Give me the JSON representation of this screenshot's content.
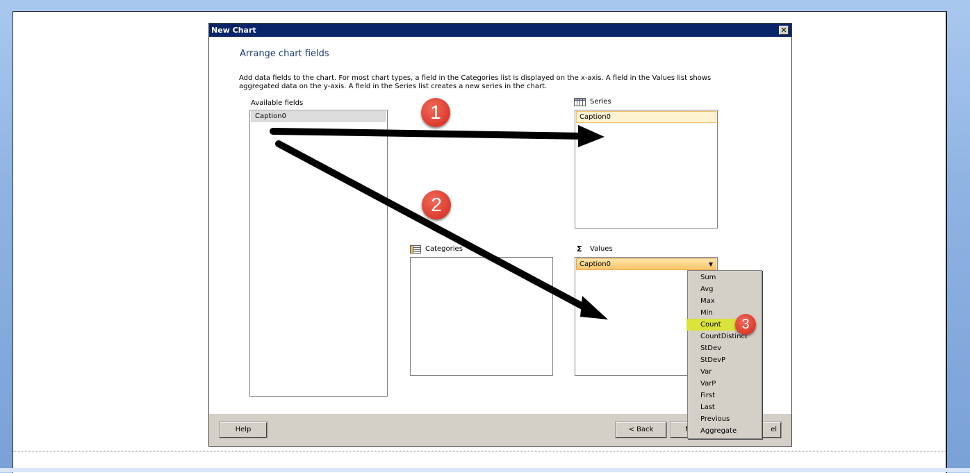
{
  "dialog": {
    "title": "New Chart",
    "close_glyph": "✕",
    "heading": "Arrange chart fields",
    "description": "Add data fields to the chart. For most chart types, a field in the Categories list is displayed on the x-axis. A field in the Values list shows aggregated data on the y-axis. A field in the Series list creates a new series in the chart."
  },
  "available_fields": {
    "label": "Available fields",
    "items": [
      "Caption0"
    ]
  },
  "series": {
    "label": "Series",
    "icon": "series-grid-icon",
    "items": [
      "Caption0"
    ]
  },
  "categories": {
    "label": "Categories",
    "icon": "categories-list-icon",
    "items": []
  },
  "values": {
    "label": "Values",
    "icon": "sigma-icon",
    "icon_glyph": "Σ",
    "items": [
      "Caption0"
    ],
    "dropdown_glyph": "▼"
  },
  "aggregate_menu": {
    "options": [
      "Sum",
      "Avg",
      "Max",
      "Min",
      "Count",
      "CountDistinct",
      "StDev",
      "StDevP",
      "Var",
      "VarP",
      "First",
      "Last",
      "Previous",
      "Aggregate"
    ],
    "highlighted": "Count"
  },
  "buttons": {
    "help": "Help",
    "back": "< Back",
    "next_fragment": "N",
    "cancel_fragment": "el"
  },
  "annotations": {
    "badge_1": "1",
    "badge_2": "2",
    "badge_3": "3"
  },
  "colors": {
    "titlebar": "#0a246a",
    "highlight": "#d9e33a",
    "badge": "#d3261a"
  }
}
